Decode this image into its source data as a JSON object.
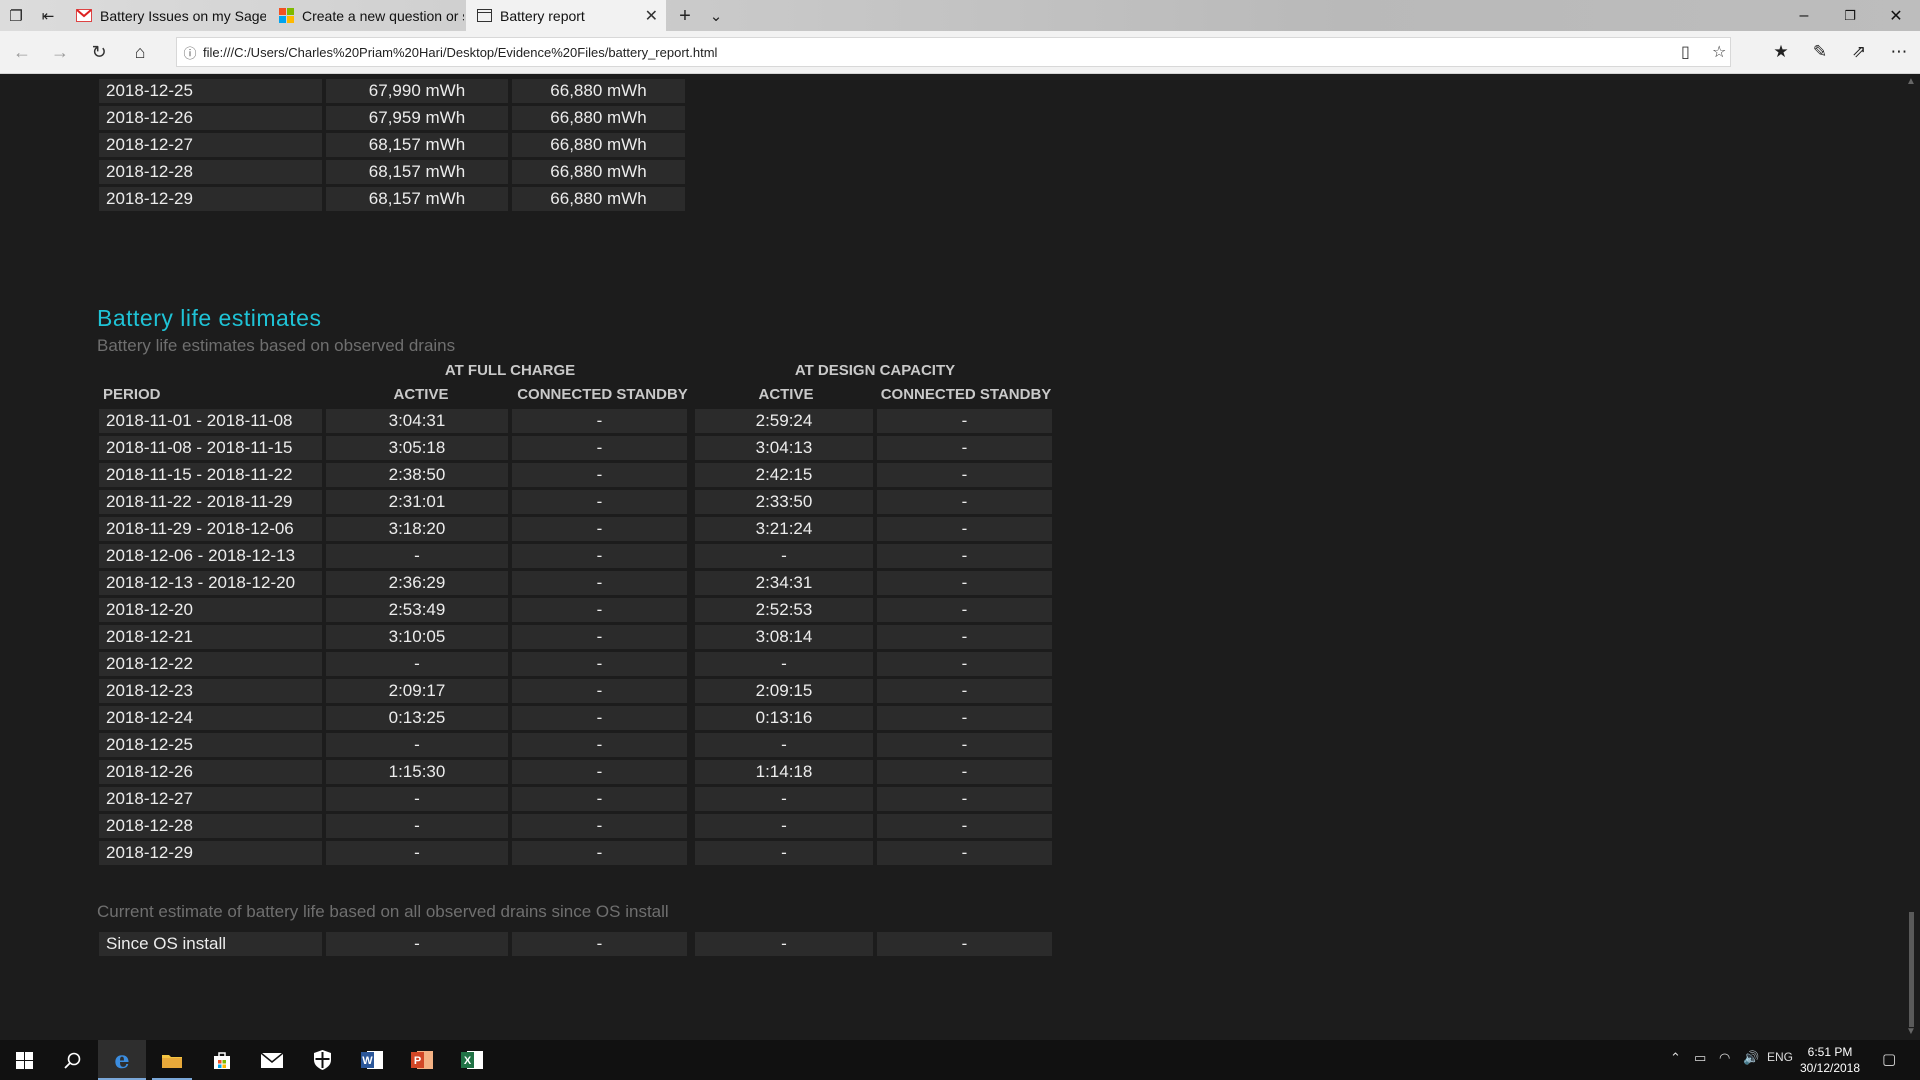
{
  "browser": {
    "tabs": [
      {
        "label": "Battery Issues on my Sager",
        "icon": "gmail-icon",
        "active": false
      },
      {
        "label": "Create a new question or st",
        "icon": "microsoft-logo-icon",
        "active": false
      },
      {
        "label": "Battery report",
        "icon": "page-icon",
        "active": true
      }
    ],
    "url": "file:///C:/Users/Charles%20Priam%20Hari/Desktop/Evidence%20Files/battery_report.html"
  },
  "capacity_history_rows": [
    [
      "2018-12-25",
      "67,990 mWh",
      "66,880 mWh"
    ],
    [
      "2018-12-26",
      "67,959 mWh",
      "66,880 mWh"
    ],
    [
      "2018-12-27",
      "68,157 mWh",
      "66,880 mWh"
    ],
    [
      "2018-12-28",
      "68,157 mWh",
      "66,880 mWh"
    ],
    [
      "2018-12-29",
      "68,157 mWh",
      "66,880 mWh"
    ]
  ],
  "estimates": {
    "title": "Battery life estimates",
    "subtitle": "Battery life estimates based on observed drains",
    "group_full": "AT FULL CHARGE",
    "group_design": "AT DESIGN CAPACITY",
    "col_period": "PERIOD",
    "col_active_1": "ACTIVE",
    "col_standby_1": "CONNECTED STANDBY",
    "col_active_2": "ACTIVE",
    "col_standby_2": "CONNECTED STANDBY",
    "rows": [
      [
        "2018-11-01 - 2018-11-08",
        "3:04:31",
        "-",
        "2:59:24",
        "-"
      ],
      [
        "2018-11-08 - 2018-11-15",
        "3:05:18",
        "-",
        "3:04:13",
        "-"
      ],
      [
        "2018-11-15 - 2018-11-22",
        "2:38:50",
        "-",
        "2:42:15",
        "-"
      ],
      [
        "2018-11-22 - 2018-11-29",
        "2:31:01",
        "-",
        "2:33:50",
        "-"
      ],
      [
        "2018-11-29 - 2018-12-06",
        "3:18:20",
        "-",
        "3:21:24",
        "-"
      ],
      [
        "2018-12-06 - 2018-12-13",
        "-",
        "-",
        "-",
        "-"
      ],
      [
        "2018-12-13 - 2018-12-20",
        "2:36:29",
        "-",
        "2:34:31",
        "-"
      ],
      [
        "2018-12-20",
        "2:53:49",
        "-",
        "2:52:53",
        "-"
      ],
      [
        "2018-12-21",
        "3:10:05",
        "-",
        "3:08:14",
        "-"
      ],
      [
        "2018-12-22",
        "-",
        "-",
        "-",
        "-"
      ],
      [
        "2018-12-23",
        "2:09:17",
        "-",
        "2:09:15",
        "-"
      ],
      [
        "2018-12-24",
        "0:13:25",
        "-",
        "0:13:16",
        "-"
      ],
      [
        "2018-12-25",
        "-",
        "-",
        "-",
        "-"
      ],
      [
        "2018-12-26",
        "1:15:30",
        "-",
        "1:14:18",
        "-"
      ],
      [
        "2018-12-27",
        "-",
        "-",
        "-",
        "-"
      ],
      [
        "2018-12-28",
        "-",
        "-",
        "-",
        "-"
      ],
      [
        "2018-12-29",
        "-",
        "-",
        "-",
        "-"
      ]
    ],
    "current_note": "Current estimate of battery life based on all observed drains since OS install",
    "since_install": [
      "Since OS install",
      "-",
      "-",
      "-",
      "-"
    ]
  },
  "taskbar": {
    "apps": [
      "windows-start-icon",
      "search-icon",
      "edge-icon",
      "file-explorer-icon",
      "store-icon",
      "mail-icon",
      "defender-icon",
      "word-icon",
      "powerpoint-icon",
      "excel-icon"
    ],
    "language": "ENG",
    "time": "6:51 PM",
    "date": "30/12/2018"
  }
}
